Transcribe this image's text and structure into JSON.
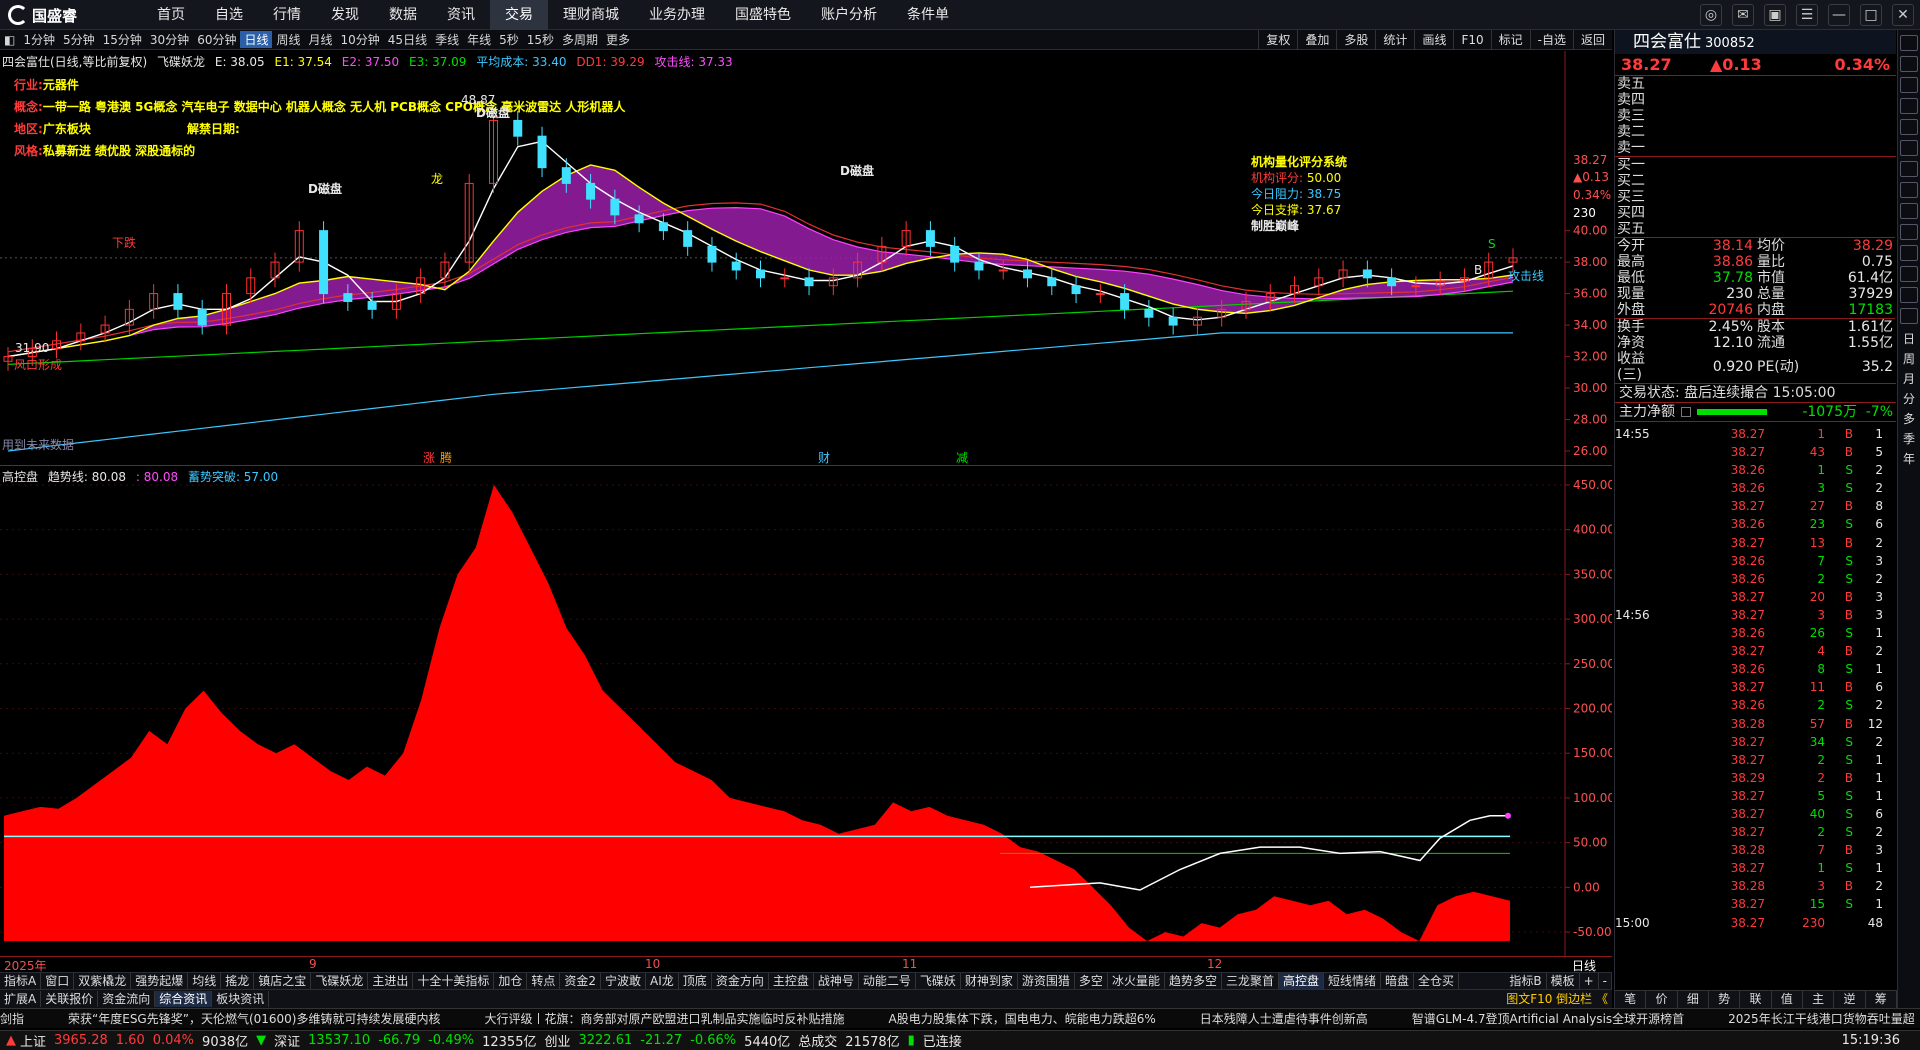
{
  "app": {
    "logo_text": "国盛睿"
  },
  "menu": [
    "首页",
    "自选",
    "行情",
    "发现",
    "数据",
    "资讯",
    "交易",
    "理财商城",
    "业务办理",
    "国盛特色",
    "账户分析",
    "条件单"
  ],
  "menu_active": "交易",
  "periods": [
    "1分钟",
    "5分钟",
    "15分钟",
    "30分钟",
    "60分钟",
    "日线",
    "周线",
    "月线",
    "10分钟",
    "45日线",
    "季线",
    "年线",
    "5秒",
    "15秒",
    "多周期",
    "更多"
  ],
  "period_active": "日线",
  "right_tools": [
    "复权",
    "叠加",
    "多股",
    "统计",
    "画线",
    "F10",
    "标记",
    "-自选",
    "返回"
  ],
  "main_legend": {
    "stock": "四会富仕(日线,等比前复权)",
    "indicator": "飞碟妖龙",
    "E": "E: 38.05",
    "E1": "E1: 37.54",
    "E2": "E2: 37.50",
    "E3": "E3: 37.09",
    "avg_cost": "平均成本: 33.40",
    "dd1": "DD1: 39.29",
    "attack": "攻击线: 37.33"
  },
  "info": {
    "industry_label": "行业:",
    "industry": "元器件",
    "concept_label": "概念:",
    "concept": "一带一路 粤港澳 5G概念 汽车电子 数据中心 机器人概念 无人机 PCB概念 CPO概念 毫米波雷达 人形机器人",
    "region_label": "地区:",
    "region": "广东板块",
    "unlock_label": "解禁日期:",
    "style_label": "风格:",
    "style": "私募新进 绩优股 深股通标的"
  },
  "chart_labels": {
    "high": "48.87",
    "low": "31.90",
    "d1": "D磁盘",
    "d2": "D磁盘",
    "d3": "D磁盘",
    "xiadie": "下跌",
    "long": "龙",
    "fengkou": "风口形成",
    "attack_line": "攻击线",
    "future": "用到未来数据",
    "zhang": "涨",
    "teng": "腾",
    "cai": "财",
    "jian": "减",
    "s_mark": "S",
    "b_mark": "B"
  },
  "score": {
    "title": "机构量化评分系统",
    "score_label": "机构评分:",
    "score": "50.00",
    "resist_label": "今日阻力:",
    "resist": "38.75",
    "support_label": "今日支撑:",
    "support": "37.67",
    "result": "制胜巅峰"
  },
  "main_axis": {
    "price_label": "38.27",
    "chg_label": "▲0.13",
    "pct_label": "0.34%",
    "vol_label": "230",
    "ticks": [
      "40.00",
      "38.00",
      "36.00",
      "34.00",
      "32.00",
      "30.00",
      "28.00",
      "26.00"
    ]
  },
  "sub_legend": {
    "name": "高控盘",
    "trend": "趋势线: 80.08",
    "val2": ": 80.08",
    "breakout": "蓄势突破: 57.00"
  },
  "sub_axis": {
    "ticks": [
      "450.00",
      "400.00",
      "350.00",
      "300.00",
      "250.00",
      "200.00",
      "150.00",
      "100.00",
      "50.00",
      "0.00",
      "-50.00"
    ]
  },
  "dates": [
    "2025年",
    "9",
    "10",
    "11",
    "12"
  ],
  "date_right": "日线",
  "tabs1": [
    "指标A",
    "窗口",
    "双紫橇龙",
    "强势起爆",
    "均线",
    "搖龙",
    "镇店之宝",
    "飞碟妖龙",
    "主进出",
    "十全十美指标",
    "加仓",
    "转点",
    "资金2",
    "宁波敢",
    "AI龙",
    "顶底",
    "资金方向",
    "主控盘",
    "战神号",
    "动能二号",
    "飞碟妖",
    "财神到家",
    "游资围猎",
    "多空",
    "冰火量能",
    "趋势多空",
    "三龙聚首",
    "高控盘",
    "短线情绪",
    "暗盘",
    "全仓买"
  ],
  "tabs1_active": "高控盘",
  "tabs1_right": [
    "指标B",
    "模板",
    "+",
    "-"
  ],
  "tabs2": [
    "扩展A",
    "关联报价",
    "资金流向",
    "综合资讯",
    "板块资讯"
  ],
  "tabs2_active": "综合资讯",
  "tabs2_right": "图文F10  倒边栏 《",
  "news": [
    "剑指",
    "荣获“年度ESG先锋奖”，天伦燃气(01600)多维铸就可持续发展硬内核",
    "大行评级丨花旗：商务部对原产欧盟进口乳制品实施临时反补贴措施",
    "A股电力股集体下跌，国电电力、皖能电力跌超6%",
    "日本残障人士遭虐待事件创新高",
    "智谱GLM-4.7登顶Artificial Analysis全球开源榜首",
    "2025年长江干线港口货物吞吐量超"
  ],
  "status": {
    "sh_label": "上证",
    "sh": "3965.28",
    "sh_chg": "1.60",
    "sh_pct": "0.04%",
    "sh_amt": "9038亿",
    "sz_label": "深证",
    "sz": "13537.10",
    "sz_chg": "-66.79",
    "sz_pct": "-0.49%",
    "sz_amt": "12355亿",
    "cy_label": "创业",
    "cy": "3222.61",
    "cy_chg": "-21.27",
    "cy_pct": "-0.66%",
    "cy_amt": "5440亿",
    "total_label": "总成交",
    "total": "21578亿",
    "conn": "已连接",
    "time": "15:19:36"
  },
  "panel": {
    "name": "四会富仕",
    "code": "300852",
    "price": "38.27",
    "chg": "▲0.13",
    "pct": "0.34%",
    "asks": [
      "卖五",
      "卖四",
      "卖三",
      "卖二",
      "卖一"
    ],
    "bids": [
      "买一",
      "买二",
      "买三",
      "买四",
      "买五"
    ],
    "quote": [
      [
        "今开",
        "38.14",
        "均价",
        "38.29"
      ],
      [
        "最高",
        "38.86",
        "量比",
        "0.75"
      ],
      [
        "最低",
        "37.78",
        "市值",
        "61.4亿"
      ],
      [
        "现量",
        "230",
        "总量",
        "37929"
      ],
      [
        "外盘",
        "20746",
        "内盘",
        "17183"
      ]
    ],
    "fund": [
      [
        "换手",
        "2.45%",
        "股本",
        "1.61亿"
      ],
      [
        "净资",
        "12.10",
        "流通",
        "1.55亿"
      ],
      [
        "收益(三)",
        "0.920",
        "PE(动)",
        "35.2"
      ]
    ],
    "trade_status": "交易状态: 盘后连续撮合 15:05:00",
    "main_net_label": "主力净额",
    "main_net": "-1075万",
    "main_net_pct": "-7%",
    "ticks": [
      [
        "14:55",
        "38.27",
        "1",
        "B",
        "1"
      ],
      [
        "",
        "38.27",
        "43",
        "B",
        "5"
      ],
      [
        "",
        "38.26",
        "1",
        "S",
        "2"
      ],
      [
        "",
        "38.26",
        "3",
        "S",
        "2"
      ],
      [
        "",
        "38.27",
        "27",
        "B",
        "8"
      ],
      [
        "",
        "38.26",
        "23",
        "S",
        "6"
      ],
      [
        "",
        "38.27",
        "13",
        "B",
        "2"
      ],
      [
        "",
        "38.26",
        "7",
        "S",
        "3"
      ],
      [
        "",
        "38.26",
        "2",
        "S",
        "2"
      ],
      [
        "",
        "38.27",
        "20",
        "B",
        "3"
      ],
      [
        "14:56",
        "38.27",
        "3",
        "B",
        "3"
      ],
      [
        "",
        "38.26",
        "26",
        "S",
        "1"
      ],
      [
        "",
        "38.27",
        "4",
        "B",
        "2"
      ],
      [
        "",
        "38.26",
        "8",
        "S",
        "1"
      ],
      [
        "",
        "38.27",
        "11",
        "B",
        "6"
      ],
      [
        "",
        "38.26",
        "2",
        "S",
        "2"
      ],
      [
        "",
        "38.28",
        "57",
        "B",
        "12"
      ],
      [
        "",
        "38.27",
        "34",
        "S",
        "2"
      ],
      [
        "",
        "38.27",
        "2",
        "S",
        "1"
      ],
      [
        "",
        "38.29",
        "2",
        "B",
        "1"
      ],
      [
        "",
        "38.27",
        "5",
        "S",
        "1"
      ],
      [
        "",
        "38.27",
        "40",
        "S",
        "6"
      ],
      [
        "",
        "38.27",
        "2",
        "S",
        "2"
      ],
      [
        "",
        "38.28",
        "7",
        "B",
        "3"
      ],
      [
        "",
        "38.27",
        "1",
        "S",
        "1"
      ],
      [
        "",
        "38.28",
        "3",
        "B",
        "2"
      ],
      [
        "",
        "38.27",
        "15",
        "S",
        "1"
      ],
      [
        "15:00",
        "38.27",
        "230",
        "",
        "48"
      ]
    ],
    "bottom_tabs": [
      "笔",
      "价",
      "细",
      "势",
      "联",
      "值",
      "主",
      "逆",
      "筹"
    ]
  },
  "side_chars": [
    "日",
    "周",
    "月",
    "分",
    "多",
    "季",
    "年"
  ],
  "colors": {
    "up": "#ff3b3b",
    "down": "#00e000",
    "bg": "#000000",
    "fill": "#ff0000"
  },
  "chart_data": [
    {
      "type": "candlestick",
      "name": "四会富仕 日线",
      "x_range": [
        "2025-08",
        "2025-12"
      ],
      "ylim": [
        26,
        48.87
      ],
      "series_lines": [
        {
          "name": "攻击线",
          "approx_current": 37.33
        },
        {
          "name": "平均成本",
          "approx_current": 33.4
        }
      ],
      "close_trend": [
        32.0,
        32.5,
        33,
        33.5,
        34,
        35,
        36,
        35,
        34,
        36,
        37,
        38,
        40,
        36,
        35.5,
        35,
        36,
        37,
        38,
        43,
        47,
        46,
        44,
        43,
        42,
        41,
        40.5,
        40,
        39,
        38,
        37.5,
        37,
        37,
        36.5,
        37,
        38,
        39,
        40,
        39,
        38,
        37.5,
        37.5,
        37,
        36.5,
        36,
        36,
        35,
        34.5,
        34,
        34.5,
        35,
        35.5,
        36,
        36.5,
        37,
        37.5,
        37,
        36.5,
        36.5,
        36.8,
        37,
        38,
        38.27
      ]
    },
    {
      "type": "area",
      "name": "高控盘",
      "ylim": [
        -60,
        460
      ],
      "values": [
        80,
        85,
        90,
        88,
        100,
        115,
        130,
        145,
        175,
        160,
        200,
        220,
        195,
        175,
        160,
        150,
        160,
        145,
        130,
        120,
        135,
        125,
        150,
        210,
        290,
        350,
        380,
        450,
        420,
        380,
        340,
        290,
        260,
        220,
        200,
        180,
        160,
        140,
        130,
        120,
        100,
        95,
        90,
        85,
        75,
        70,
        60,
        65,
        70,
        95,
        85,
        90,
        80,
        75,
        70,
        60,
        45,
        40,
        30,
        20,
        0,
        -20,
        -45,
        -60,
        -50,
        -55,
        -40,
        -45,
        -30,
        -25,
        -10,
        -15,
        -20,
        -15,
        -30,
        -25,
        -35,
        -50,
        -60,
        -20,
        -10,
        -5,
        -10,
        -15
      ],
      "trend_line_current": 80.08,
      "breakout_line": 57.0
    }
  ]
}
